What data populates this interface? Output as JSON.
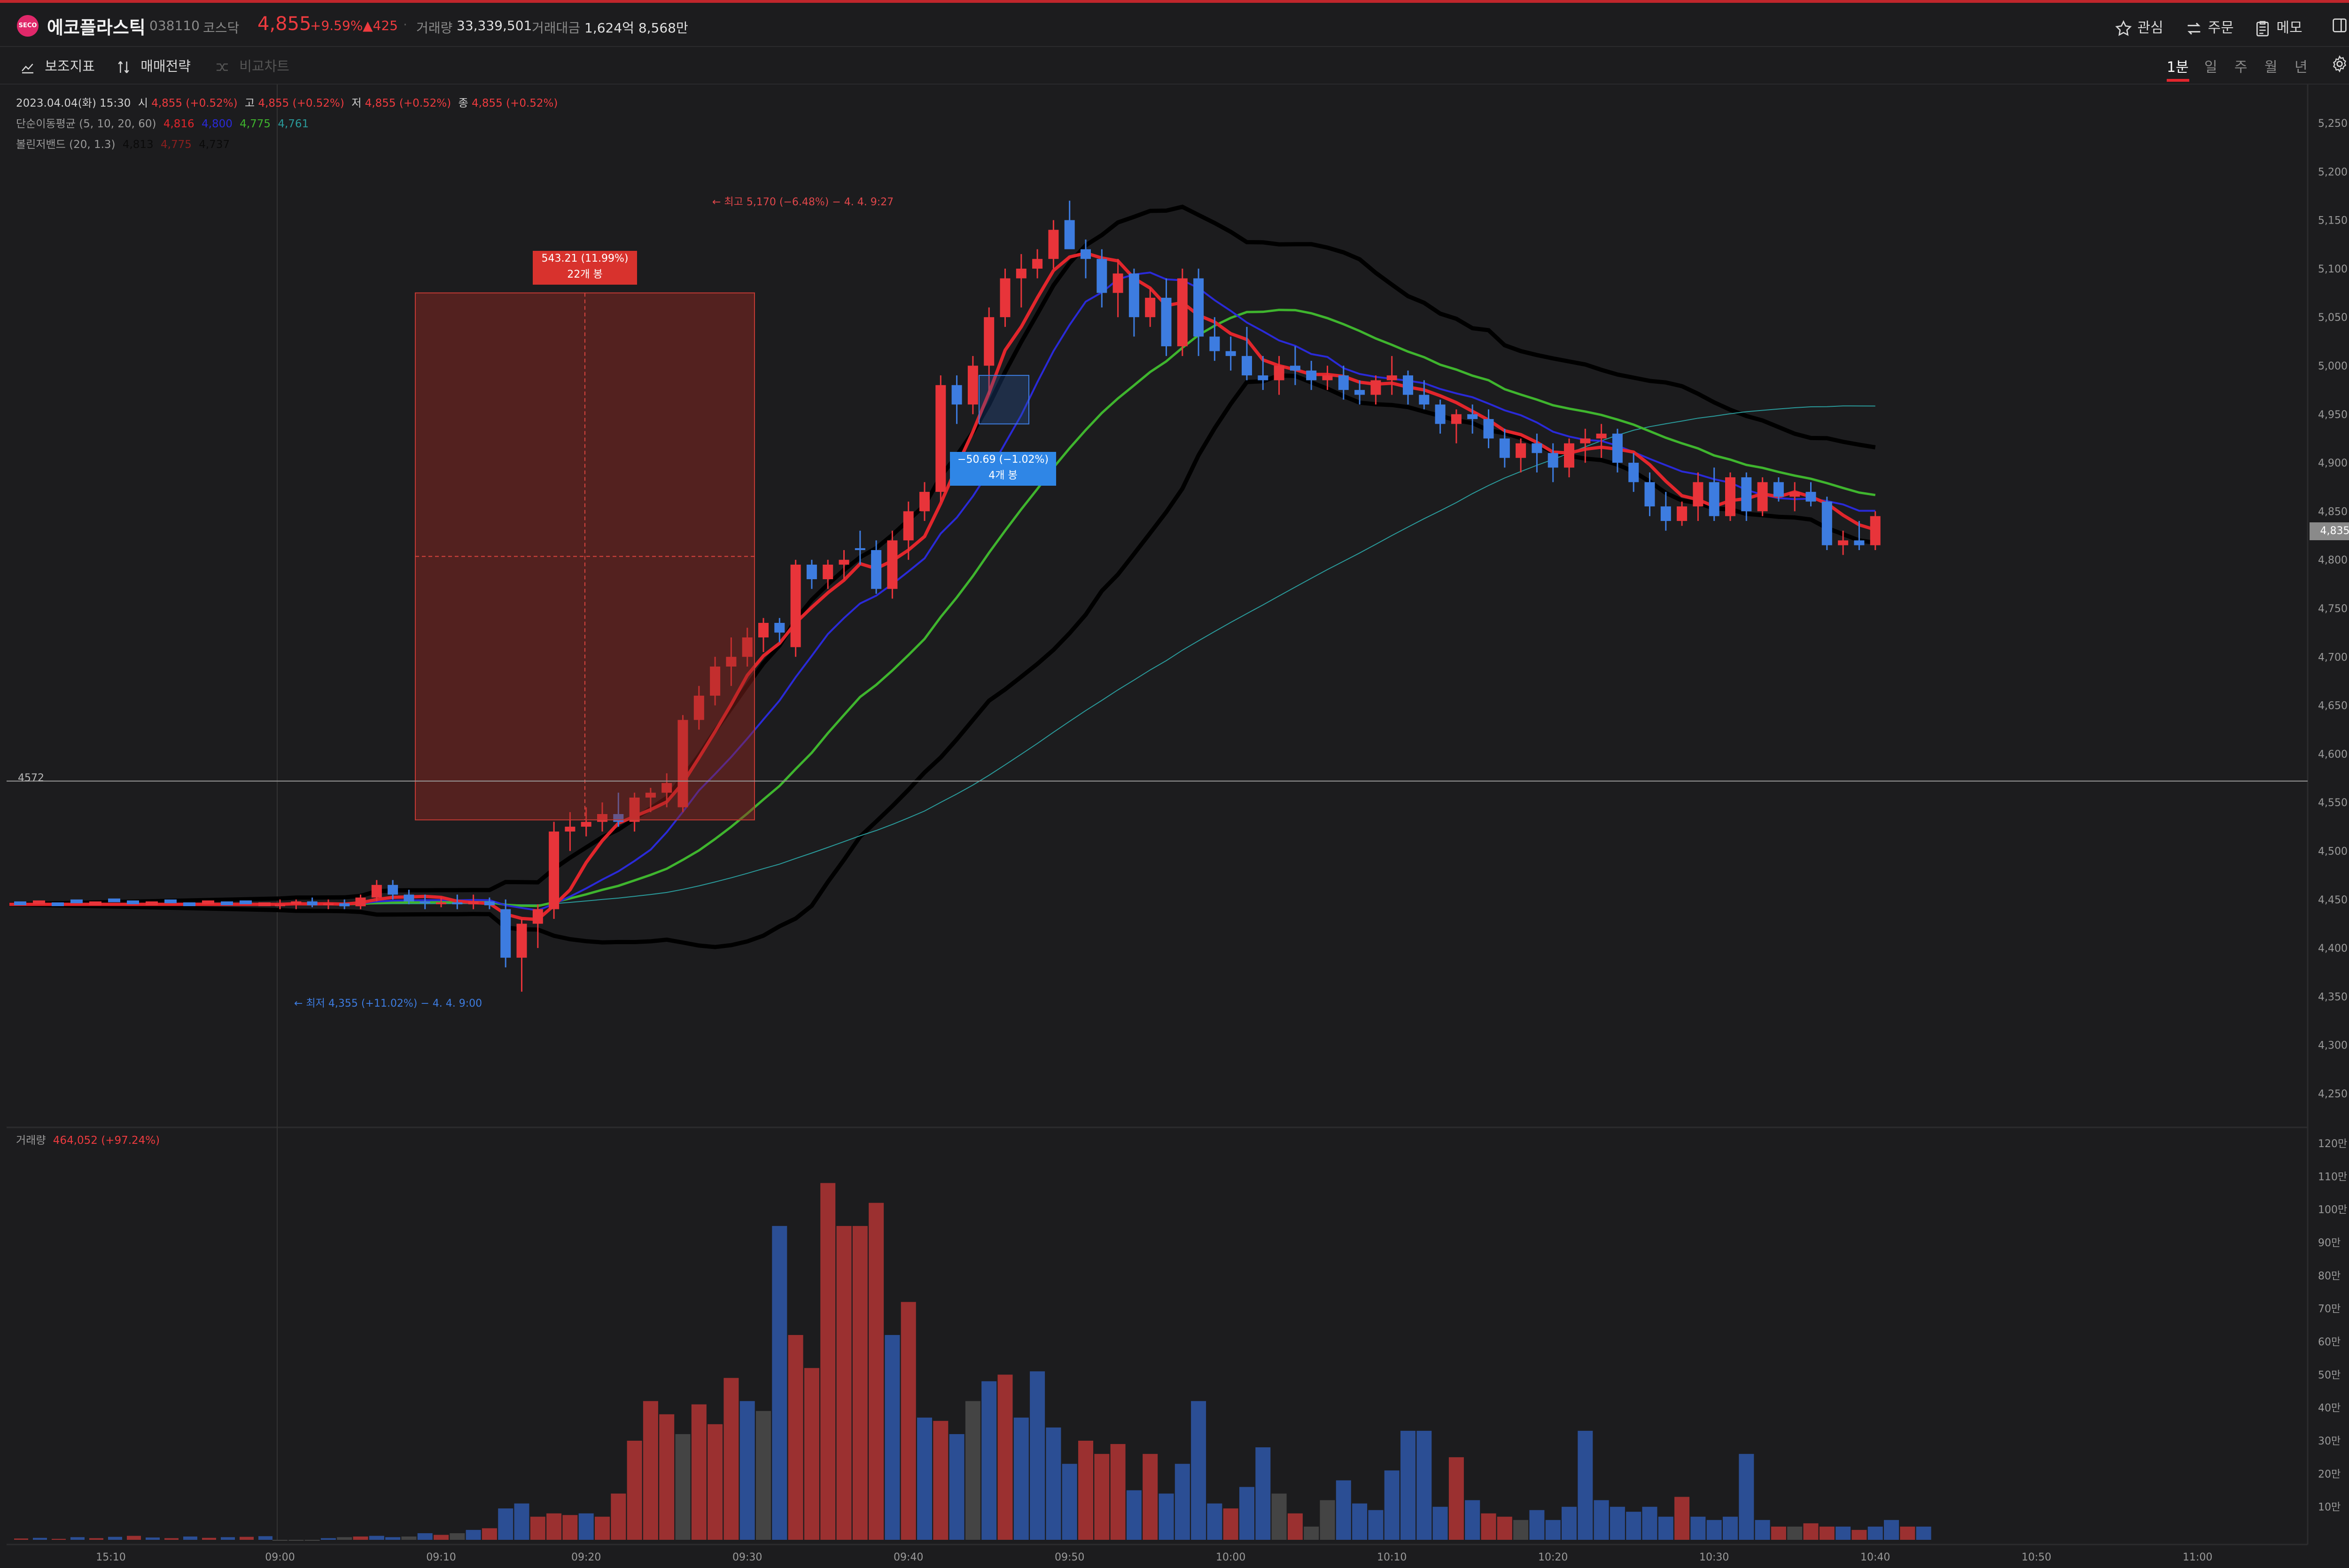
{
  "header": {
    "logo_text": "SECO",
    "stock_name": "에코플라스틱",
    "code": "038110",
    "market": "코스닥",
    "price": "4,855",
    "change_pct": "+9.59%",
    "change_amt": "▲425",
    "volume_label": "거래량",
    "volume_value": "33,339,501",
    "amount_label": "거래대금",
    "amount_value": "1,624억 8,568만",
    "right_buttons": [
      "관심",
      "주문",
      "메모"
    ]
  },
  "toolbar": {
    "indicator_label": "보조지표",
    "strategy_label": "매매전략",
    "compare_label": "비교차트",
    "periods": [
      "1분",
      "일",
      "주",
      "월",
      "년"
    ],
    "active_period": "1분"
  },
  "legend": {
    "ohlc_line": {
      "date": "2023.04.04(화) 15:30",
      "open_label": "시",
      "open": "4,855 (+0.52%)",
      "high_label": "고",
      "high": "4,855 (+0.52%)",
      "low_label": "저",
      "low": "4,855 (+0.52%)",
      "close_label": "종",
      "close": "4,855 (+0.52%)"
    },
    "ma": {
      "label": "단순이동평균 (5, 10, 20, 60)",
      "v5": "4,816",
      "v10": "4,800",
      "v20": "4,775",
      "v60": "4,761"
    },
    "bb": {
      "label": "볼린저밴드 (20, 1.3)",
      "upper": "4,813",
      "mid": "4,775",
      "lower": "4,737"
    },
    "volume": {
      "label": "거래량",
      "value": "464,052 (+97.24%)"
    }
  },
  "annotations": {
    "high_note": "← 최고 5,170 (−6.48%) − 4. 4. 9:27",
    "low_note": "← 최저 4,355 (+11.02%) − 4. 4. 9:00",
    "measure_up_line1": "543.21 (11.99%)",
    "measure_up_line2": "22개 봉",
    "measure_down_line1": "−50.69 (−1.02%)",
    "measure_down_line2": "4개 봉",
    "hline_label": "4572",
    "current_price_tag": "4,835"
  },
  "colors": {
    "up": "#e8343a",
    "down": "#3d7ce0",
    "ma5": "#e2262c",
    "ma10": "#2a2ad8",
    "ma20": "#3fb52e",
    "ma60": "#2a9a9a",
    "bb": "#000000",
    "vol_up": "#9b3030",
    "vol_down": "#2b4e94",
    "vol_flat": "#444444",
    "bg": "#1c1c1e",
    "grid": "#262628"
  },
  "chart_data": {
    "type": "candlestick",
    "interval": "1분",
    "price_ylim": [
      4220,
      5280
    ],
    "price_ticks": [
      "5,250",
      "5,200",
      "5,150",
      "5,100",
      "5,050",
      "5,000",
      "4,950",
      "4,900",
      "4,850",
      "4,800",
      "4,750",
      "4,700",
      "4,650",
      "4,600",
      "4,550",
      "4,500",
      "4,450",
      "4,400",
      "4,350",
      "4,300",
      "4,250"
    ],
    "volume_ylim": [
      0,
      1220000
    ],
    "volume_ticks": [
      "120만",
      "110만",
      "100만",
      "90만",
      "80만",
      "70만",
      "60만",
      "50만",
      "40만",
      "30만",
      "20만",
      "10만"
    ],
    "x_tick_labels": [
      "15:10",
      "09:00",
      "09:10",
      "09:20",
      "09:30",
      "09:40",
      "09:50",
      "10:00",
      "10:10",
      "10:20",
      "10:30",
      "10:40",
      "10:50",
      "11:00"
    ],
    "x_tick_index": [
      -11,
      0,
      10,
      19,
      29,
      39,
      49,
      59,
      69,
      79,
      89,
      99,
      109,
      119
    ],
    "ohlc": [
      [
        4445,
        4450,
        4440,
        4445
      ],
      [
        4445,
        4450,
        4440,
        4448
      ],
      [
        4448,
        4452,
        4442,
        4444
      ],
      [
        4444,
        4450,
        4440,
        4446
      ],
      [
        4446,
        4450,
        4440,
        4443
      ],
      [
        4443,
        4455,
        4440,
        4452
      ],
      [
        4452,
        4470,
        4448,
        4465
      ],
      [
        4465,
        4470,
        4450,
        4455
      ],
      [
        4455,
        4460,
        4445,
        4448
      ],
      [
        4448,
        4455,
        4440,
        4446
      ],
      [
        4446,
        4452,
        4442,
        4447
      ],
      [
        4447,
        4455,
        4440,
        4445
      ],
      [
        4445,
        4455,
        4440,
        4448
      ],
      [
        4448,
        4452,
        4440,
        4444
      ],
      [
        4440,
        4450,
        4380,
        4390
      ],
      [
        4390,
        4430,
        4355,
        4425
      ],
      [
        4425,
        4445,
        4400,
        4440
      ],
      [
        4440,
        4530,
        4430,
        4520
      ],
      [
        4520,
        4540,
        4500,
        4525
      ],
      [
        4525,
        4545,
        4515,
        4530
      ],
      [
        4530,
        4550,
        4520,
        4538
      ],
      [
        4538,
        4560,
        4525,
        4530
      ],
      [
        4530,
        4560,
        4520,
        4555
      ],
      [
        4555,
        4565,
        4540,
        4560
      ],
      [
        4560,
        4580,
        4545,
        4570
      ],
      [
        4545,
        4640,
        4540,
        4635
      ],
      [
        4635,
        4670,
        4625,
        4660
      ],
      [
        4660,
        4700,
        4650,
        4690
      ],
      [
        4690,
        4720,
        4670,
        4700
      ],
      [
        4700,
        4730,
        4690,
        4720
      ],
      [
        4720,
        4740,
        4705,
        4735
      ],
      [
        4735,
        4740,
        4715,
        4725
      ],
      [
        4710,
        4800,
        4700,
        4795
      ],
      [
        4795,
        4800,
        4770,
        4780
      ],
      [
        4780,
        4800,
        4770,
        4795
      ],
      [
        4795,
        4810,
        4780,
        4800
      ],
      [
        4812,
        4830,
        4795,
        4810
      ],
      [
        4810,
        4820,
        4765,
        4770
      ],
      [
        4770,
        4830,
        4760,
        4820
      ],
      [
        4820,
        4860,
        4800,
        4850
      ],
      [
        4850,
        4880,
        4840,
        4870
      ],
      [
        4870,
        4990,
        4860,
        4980
      ],
      [
        4980,
        4990,
        4940,
        4960
      ],
      [
        4960,
        5010,
        4950,
        5000
      ],
      [
        5000,
        5060,
        4970,
        5050
      ],
      [
        5050,
        5100,
        5040,
        5090
      ],
      [
        5090,
        5115,
        5060,
        5100
      ],
      [
        5100,
        5120,
        5090,
        5110
      ],
      [
        5110,
        5150,
        5100,
        5140
      ],
      [
        5150,
        5170,
        5130,
        5120
      ],
      [
        5120,
        5130,
        5090,
        5110
      ],
      [
        5110,
        5120,
        5060,
        5075
      ],
      [
        5075,
        5110,
        5050,
        5095
      ],
      [
        5095,
        5100,
        5030,
        5050
      ],
      [
        5050,
        5080,
        5040,
        5070
      ],
      [
        5070,
        5090,
        5010,
        5020
      ],
      [
        5020,
        5100,
        5010,
        5090
      ],
      [
        5090,
        5100,
        5010,
        5030
      ],
      [
        5030,
        5050,
        5005,
        5015
      ],
      [
        5015,
        5030,
        4995,
        5010
      ],
      [
        5010,
        5040,
        4985,
        4990
      ],
      [
        4990,
        5010,
        4975,
        4985
      ],
      [
        4985,
        5010,
        4970,
        5000
      ],
      [
        5000,
        5020,
        4980,
        4995
      ],
      [
        4995,
        5005,
        4975,
        4985
      ],
      [
        4985,
        5000,
        4975,
        4990
      ],
      [
        4990,
        5000,
        4965,
        4975
      ],
      [
        4975,
        4985,
        4960,
        4970
      ],
      [
        4970,
        4990,
        4960,
        4985
      ],
      [
        4985,
        5010,
        4970,
        4990
      ],
      [
        4990,
        4995,
        4960,
        4970
      ],
      [
        4970,
        4985,
        4955,
        4960
      ],
      [
        4960,
        4965,
        4930,
        4940
      ],
      [
        4940,
        4955,
        4920,
        4950
      ],
      [
        4950,
        4960,
        4930,
        4945
      ],
      [
        4945,
        4955,
        4915,
        4925
      ],
      [
        4925,
        4935,
        4895,
        4905
      ],
      [
        4905,
        4925,
        4890,
        4920
      ],
      [
        4920,
        4930,
        4890,
        4910
      ],
      [
        4910,
        4920,
        4880,
        4895
      ],
      [
        4895,
        4925,
        4885,
        4920
      ],
      [
        4920,
        4935,
        4900,
        4925
      ],
      [
        4925,
        4940,
        4905,
        4930
      ],
      [
        4930,
        4935,
        4890,
        4900
      ],
      [
        4900,
        4910,
        4870,
        4880
      ],
      [
        4880,
        4890,
        4845,
        4855
      ],
      [
        4855,
        4870,
        4830,
        4840
      ],
      [
        4840,
        4860,
        4835,
        4855
      ],
      [
        4855,
        4890,
        4840,
        4880
      ],
      [
        4880,
        4895,
        4840,
        4845
      ],
      [
        4845,
        4890,
        4840,
        4885
      ],
      [
        4885,
        4890,
        4840,
        4850
      ],
      [
        4850,
        4885,
        4845,
        4880
      ],
      [
        4880,
        4885,
        4860,
        4865
      ],
      [
        4865,
        4880,
        4850,
        4870
      ],
      [
        4870,
        4880,
        4855,
        4860
      ],
      [
        4860,
        4865,
        4810,
        4815
      ],
      [
        4815,
        4830,
        4805,
        4820
      ],
      [
        4820,
        4840,
        4810,
        4815
      ],
      [
        4815,
        4850,
        4810,
        4845
      ]
    ],
    "volume": [
      [
        0,
        "flat"
      ],
      [
        0,
        "flat"
      ],
      [
        0,
        "flat"
      ],
      [
        5000,
        "down"
      ],
      [
        8000,
        "flat"
      ],
      [
        10000,
        "up"
      ],
      [
        12000,
        "down"
      ],
      [
        8000,
        "down"
      ],
      [
        10000,
        "flat"
      ],
      [
        20000,
        "down"
      ],
      [
        15000,
        "up"
      ],
      [
        20000,
        "flat"
      ],
      [
        30000,
        "down"
      ],
      [
        35000,
        "up"
      ],
      [
        95000,
        "down"
      ],
      [
        110000,
        "down"
      ],
      [
        70000,
        "up"
      ],
      [
        80000,
        "up"
      ],
      [
        75000,
        "up"
      ],
      [
        80000,
        "down"
      ],
      [
        70000,
        "up"
      ],
      [
        140000,
        "up"
      ],
      [
        300000,
        "up"
      ],
      [
        420000,
        "up"
      ],
      [
        380000,
        "up"
      ],
      [
        320000,
        "flat"
      ],
      [
        410000,
        "up"
      ],
      [
        350000,
        "up"
      ],
      [
        490000,
        "up"
      ],
      [
        420000,
        "down"
      ],
      [
        390000,
        "flat"
      ],
      [
        950000,
        "down"
      ],
      [
        620000,
        "up"
      ],
      [
        520000,
        "up"
      ],
      [
        1080000,
        "up"
      ],
      [
        950000,
        "up"
      ],
      [
        950000,
        "up"
      ],
      [
        1020000,
        "up"
      ],
      [
        620000,
        "down"
      ],
      [
        720000,
        "up"
      ],
      [
        370000,
        "down"
      ],
      [
        360000,
        "up"
      ],
      [
        320000,
        "down"
      ],
      [
        420000,
        "flat"
      ],
      [
        480000,
        "down"
      ],
      [
        500000,
        "up"
      ],
      [
        370000,
        "down"
      ],
      [
        510000,
        "down"
      ],
      [
        340000,
        "down"
      ],
      [
        230000,
        "down"
      ],
      [
        300000,
        "up"
      ],
      [
        260000,
        "up"
      ],
      [
        290000,
        "up"
      ],
      [
        150000,
        "down"
      ],
      [
        260000,
        "up"
      ],
      [
        140000,
        "down"
      ],
      [
        230000,
        "down"
      ],
      [
        420000,
        "down"
      ],
      [
        110000,
        "down"
      ],
      [
        95000,
        "up"
      ],
      [
        160000,
        "down"
      ],
      [
        280000,
        "down"
      ],
      [
        140000,
        "flat"
      ],
      [
        80000,
        "up"
      ],
      [
        40000,
        "flat"
      ],
      [
        120000,
        "flat"
      ],
      [
        180000,
        "down"
      ],
      [
        110000,
        "down"
      ],
      [
        90000,
        "down"
      ],
      [
        210000,
        "down"
      ],
      [
        330000,
        "down"
      ],
      [
        330000,
        "down"
      ],
      [
        100000,
        "down"
      ],
      [
        250000,
        "up"
      ],
      [
        120000,
        "down"
      ],
      [
        80000,
        "up"
      ],
      [
        70000,
        "up"
      ],
      [
        60000,
        "flat"
      ],
      [
        90000,
        "down"
      ],
      [
        60000,
        "down"
      ],
      [
        100000,
        "down"
      ],
      [
        330000,
        "down"
      ],
      [
        120000,
        "down"
      ],
      [
        100000,
        "down"
      ],
      [
        85000,
        "down"
      ],
      [
        100000,
        "down"
      ],
      [
        70000,
        "down"
      ],
      [
        130000,
        "up"
      ],
      [
        70000,
        "down"
      ],
      [
        60000,
        "down"
      ],
      [
        70000,
        "down"
      ],
      [
        260000,
        "down"
      ],
      [
        60000,
        "down"
      ],
      [
        40000,
        "up"
      ],
      [
        40000,
        "flat"
      ],
      [
        50000,
        "up"
      ],
      [
        40000,
        "up"
      ],
      [
        40000,
        "down"
      ],
      [
        30000,
        "up"
      ],
      [
        40000,
        "down"
      ],
      [
        60000,
        "down"
      ],
      [
        40000,
        "up"
      ],
      [
        40000,
        "down"
      ]
    ]
  }
}
